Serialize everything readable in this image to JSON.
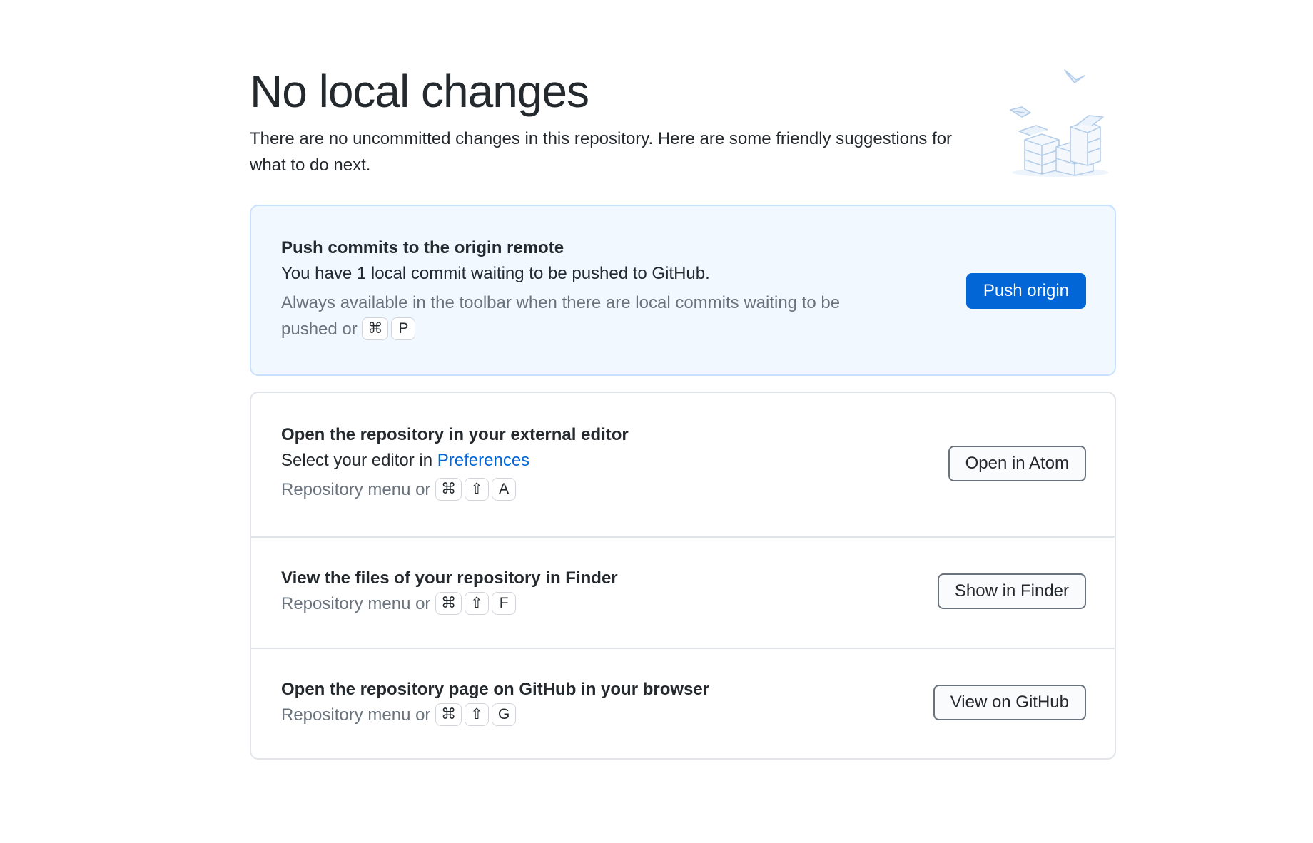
{
  "header": {
    "title": "No local changes",
    "subtitle": "There are no uncommitted changes in this repository. Here are some friendly suggestions for what to do next."
  },
  "push": {
    "title": "Push commits to the origin remote",
    "description": "You have 1 local commit waiting to be pushed to GitHub.",
    "hint": "Always available in the toolbar when there are local commits waiting to be pushed or",
    "keys": [
      "⌘",
      "P"
    ],
    "button": "Push origin"
  },
  "editor": {
    "title": "Open the repository in your external editor",
    "description_prefix": "Select your editor in ",
    "description_link": "Preferences",
    "hint": "Repository menu or",
    "keys": [
      "⌘",
      "⇧",
      "A"
    ],
    "button": "Open in Atom"
  },
  "finder": {
    "title": "View the files of your repository in Finder",
    "hint": "Repository menu or",
    "keys": [
      "⌘",
      "⇧",
      "F"
    ],
    "button": "Show in Finder"
  },
  "github": {
    "title": "Open the repository page on GitHub in your browser",
    "hint": "Repository menu or",
    "keys": [
      "⌘",
      "⇧",
      "G"
    ],
    "button": "View on GitHub"
  },
  "colors": {
    "accent": "#0366d6",
    "featured_background": "#f1f8ff",
    "border": "#e1e4e8",
    "muted_text": "#6a737d"
  },
  "icons": {
    "illustration": "boxes-illustration"
  }
}
